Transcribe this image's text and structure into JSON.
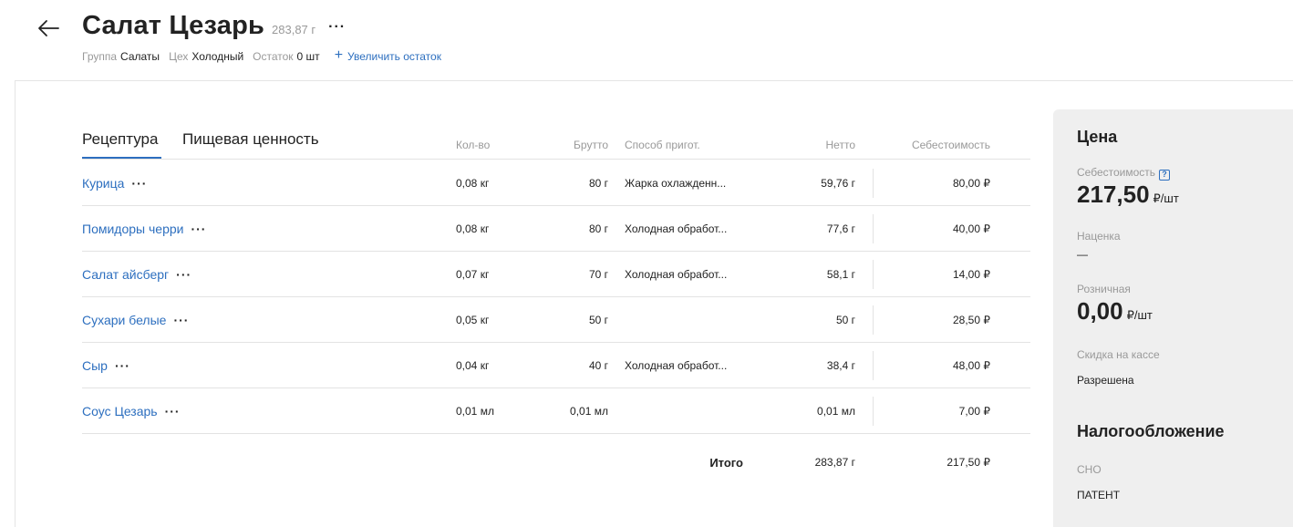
{
  "header": {
    "title": "Салат Цезарь",
    "weight": "283,87 г",
    "more": "···",
    "group_label": "Группа",
    "group_value": "Салаты",
    "workshop_label": "Цех",
    "workshop_value": "Холодный",
    "stock_label": "Остаток",
    "stock_value": "0 шт",
    "increase_stock": "Увеличить остаток"
  },
  "tabs": [
    {
      "label": "Рецептура",
      "active": true
    },
    {
      "label": "Пищевая ценность",
      "active": false
    }
  ],
  "columns": {
    "qty": "Кол-во",
    "brutto": "Брутто",
    "method": "Способ пригот.",
    "netto": "Нетто",
    "cost": "Себестоимость"
  },
  "rows": [
    {
      "name": "Курица",
      "qty": "0,08 кг",
      "brutto": "80 г",
      "method": "Жарка охлажденн...",
      "netto": "59,76 г",
      "cost": "80,00 ₽"
    },
    {
      "name": "Помидоры черри",
      "qty": "0,08 кг",
      "brutto": "80 г",
      "method": "Холодная обработ...",
      "netto": "77,6 г",
      "cost": "40,00 ₽"
    },
    {
      "name": "Салат айсберг",
      "qty": "0,07 кг",
      "brutto": "70 г",
      "method": "Холодная обработ...",
      "netto": "58,1 г",
      "cost": "14,00 ₽"
    },
    {
      "name": "Сухари белые",
      "qty": "0,05 кг",
      "brutto": "50 г",
      "method": "",
      "netto": "50 г",
      "cost": "28,50 ₽"
    },
    {
      "name": "Сыр",
      "qty": "0,04 кг",
      "brutto": "40 г",
      "method": "Холодная обработ...",
      "netto": "38,4 г",
      "cost": "48,00 ₽"
    },
    {
      "name": "Соус Цезарь",
      "qty": "0,01 мл",
      "brutto": "0,01 мл",
      "method": "",
      "netto": "0,01 мл",
      "cost": "7,00 ₽"
    }
  ],
  "total": {
    "label": "Итого",
    "netto": "283,87 г",
    "cost": "217,50 ₽"
  },
  "price_panel": {
    "title": "Цена",
    "cost_label": "Себестоимость",
    "help_icon": "?",
    "cost_value": "217,50",
    "cost_unit": "₽/шт",
    "markup_label": "Наценка",
    "markup_value": "—",
    "retail_label": "Розничная",
    "retail_value": "0,00",
    "retail_unit": "₽/шт",
    "discount_label": "Скидка на кассе",
    "discount_value": "Разрешена",
    "tax_title": "Налогообложение",
    "tax_system_label": "СНО",
    "tax_system_value": "ПАТЕНТ"
  },
  "colors": {
    "accent": "#2d6fbf",
    "panel_bg": "#efefef",
    "muted_text": "#999999"
  }
}
